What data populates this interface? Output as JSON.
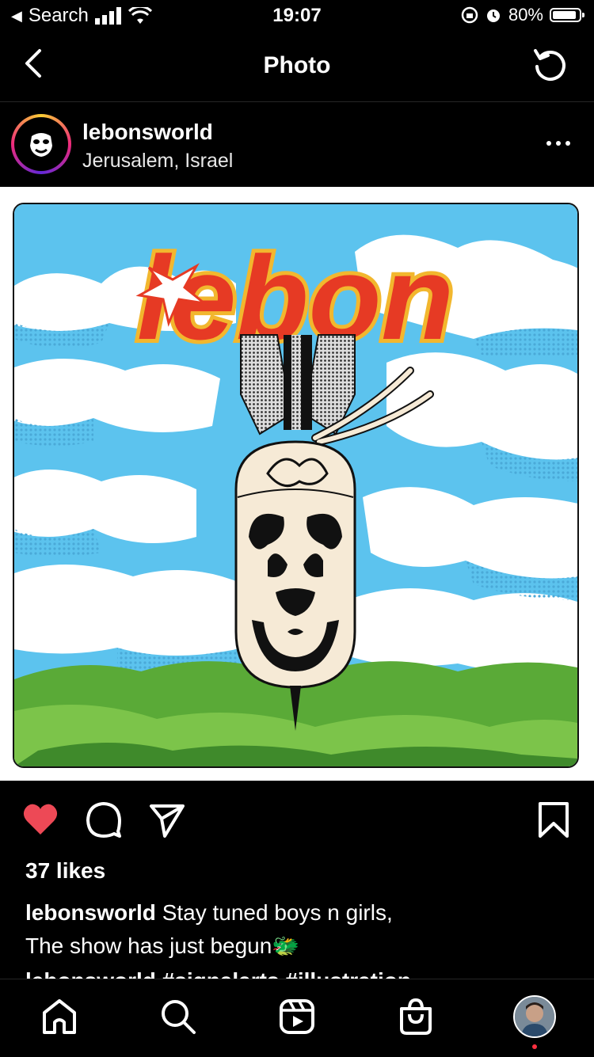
{
  "status_bar": {
    "back_app": "Search",
    "time": "19:07",
    "battery": "80%"
  },
  "nav": {
    "title": "Photo"
  },
  "post": {
    "username": "lebonsworld",
    "location": "Jerusalem, Israel",
    "artwork_text": "lebon",
    "likes": "37 likes",
    "caption_user": "lebonsworld",
    "caption_text_line1": "Stay tuned boys n girls,",
    "caption_text_line2": "The show has just begun",
    "caption_emoji": "🐲",
    "next_caption_partial": "lebonsworld #signalarts #illustration"
  },
  "icons": {
    "back": "chevron-left-icon",
    "refresh": "refresh-icon",
    "more": "more-icon",
    "like": "heart-icon",
    "comment": "comment-icon",
    "share": "send-icon",
    "save": "bookmark-icon",
    "home": "home-icon",
    "search": "search-icon",
    "reels": "reels-icon",
    "shop": "shop-icon"
  },
  "colors": {
    "like_red": "#ed4956",
    "sky_blue": "#5cc3ee",
    "grass_green": "#5aaa37",
    "logo_red": "#e63a24",
    "logo_yellow": "#f2b72e",
    "bomb_cream": "#f6ead6"
  }
}
